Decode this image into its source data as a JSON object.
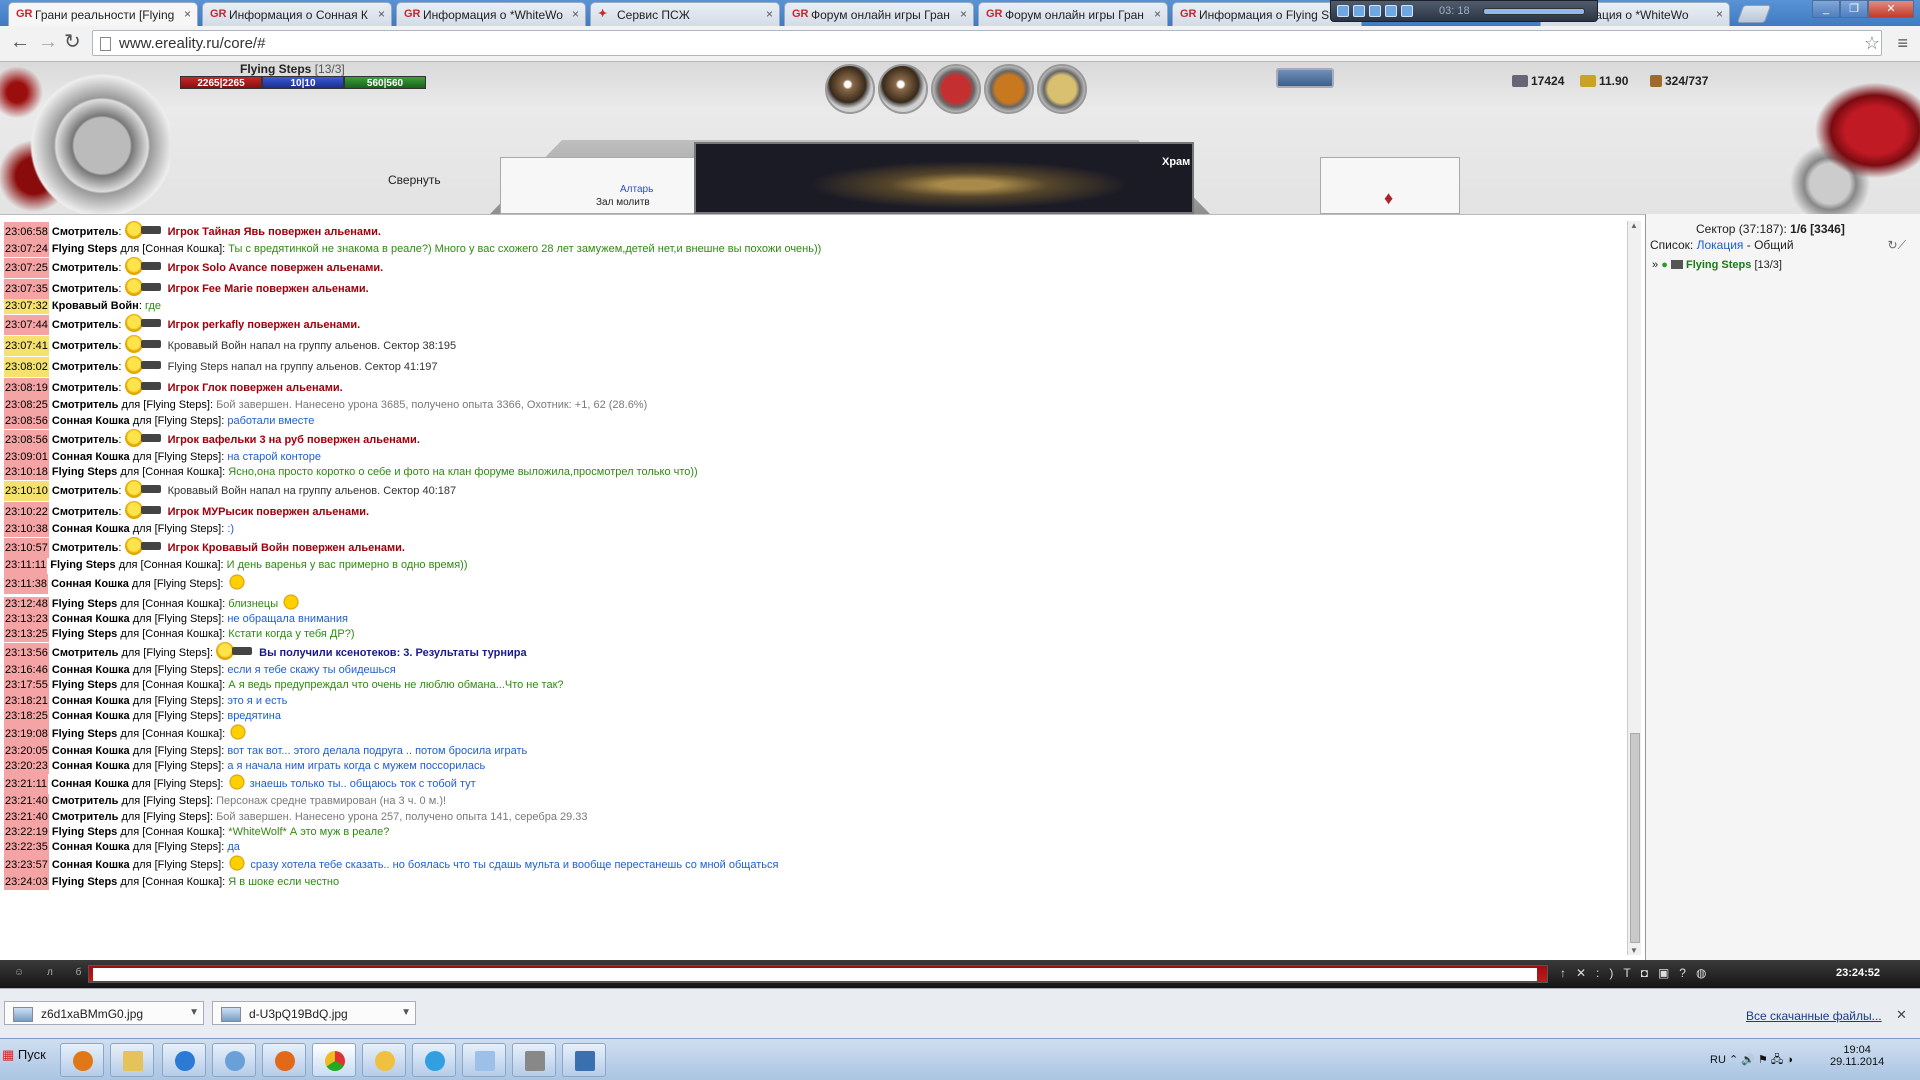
{
  "browser": {
    "tabs": [
      {
        "title": "Грани реальности [Flying"
      },
      {
        "title": "Информация о Сонная К"
      },
      {
        "title": "Информация о *WhiteWo"
      },
      {
        "title": "Сервис ПСЖ"
      },
      {
        "title": "Форум онлайн игры Гран"
      },
      {
        "title": "Форум онлайн игры Гран"
      },
      {
        "title": "Информация о Flying Ste"
      },
      {
        "title": "рормация о *WhiteWo"
      }
    ],
    "url": "www.ereality.ru/core/#",
    "media_time": "03: 18"
  },
  "player": {
    "name": "Flying Steps",
    "level": "[13/3]",
    "hp": "2265|2265",
    "mana": "10|10",
    "stamina": "560|560"
  },
  "stats": {
    "money": "17424",
    "gold": "11.90",
    "weight": "324/737"
  },
  "location": {
    "collapse_label": "Свернуть",
    "place": "Храм",
    "link": "Алтарь",
    "sub": "Зал молитв"
  },
  "chat": [
    {
      "time": "23:06:58",
      "tsc": "r",
      "name": "Смотритель",
      "sep": ":",
      "emo": "alien",
      "text": "Игрок Тайная Явь повержен альенами.",
      "cls": "sys"
    },
    {
      "time": "23:07:24",
      "tsc": "r",
      "name": "Flying Steps",
      "sep": " для [Сонная Кошка]:",
      "text": "Ты с вредятинкой не знакома в реале?) Много у вас схожего 28 лет замужем,детей нет,и внешне вы похожи очень))",
      "cls": "tx"
    },
    {
      "time": "23:07:25",
      "tsc": "r",
      "name": "Смотритель",
      "sep": ":",
      "emo": "alien",
      "text": "Игрок Solo Avance повержен альенами.",
      "cls": "sys"
    },
    {
      "time": "23:07:35",
      "tsc": "r",
      "name": "Смотритель",
      "sep": ":",
      "emo": "alien",
      "text": "Игрок Fee Marie повержен альенами.",
      "cls": "sys"
    },
    {
      "time": "23:07:32",
      "tsc": "y",
      "name": "Кровавый Войн",
      "sep": ":",
      "text": "где",
      "cls": "tx"
    },
    {
      "time": "23:07:44",
      "tsc": "r",
      "name": "Смотритель",
      "sep": ":",
      "emo": "alien",
      "text": "Игрок perkafly повержен альенами.",
      "cls": "sys"
    },
    {
      "time": "23:07:41",
      "tsc": "y",
      "name": "Смотритель",
      "sep": ":",
      "emo": "alien",
      "text": "Кровавый Войн напал на группу альенов. Сектор 38:195",
      "cls": "dk"
    },
    {
      "time": "23:08:02",
      "tsc": "y",
      "name": "Смотритель",
      "sep": ":",
      "emo": "alien",
      "text": "Flying Steps напал на группу альенов. Сектор 41:197",
      "cls": "dk"
    },
    {
      "time": "23:08:19",
      "tsc": "r",
      "name": "Смотритель",
      "sep": ":",
      "emo": "alien",
      "text": "Игрок Глок повержен альенами.",
      "cls": "sys"
    },
    {
      "time": "23:08:25",
      "tsc": "r",
      "name": "Смотритель",
      "sep": " для [Flying Steps]:",
      "text": "Бой завершен. Нанесено урона 3685, получено опыта 3366, Охотник: +1, 62 (28.6%)",
      "cls": "gr"
    },
    {
      "time": "23:08:56",
      "tsc": "r",
      "name": "Сонная Кошка",
      "sep": " для [Flying Steps]:",
      "text": "работали вместе",
      "cls": "bl"
    },
    {
      "time": "23:08:56",
      "tsc": "r",
      "name": "Смотритель",
      "sep": ":",
      "emo": "alien",
      "text": "Игрок вафельки 3 на руб повержен альенами.",
      "cls": "sys"
    },
    {
      "time": "23:09:01",
      "tsc": "r",
      "name": "Сонная Кошка",
      "sep": " для [Flying Steps]:",
      "text": "на старой конторе",
      "cls": "bl"
    },
    {
      "time": "23:10:18",
      "tsc": "r",
      "name": "Flying Steps",
      "sep": " для [Сонная Кошка]:",
      "text": "Ясно,она просто коротко о себе и фото на клан форуме выложила,просмотрел только что))",
      "cls": "tx"
    },
    {
      "time": "23:10:10",
      "tsc": "y",
      "name": "Смотритель",
      "sep": ":",
      "emo": "alien",
      "text": "Кровавый Войн напал на группу альенов. Сектор 40:187",
      "cls": "dk"
    },
    {
      "time": "23:10:22",
      "tsc": "r",
      "name": "Смотритель",
      "sep": ":",
      "emo": "alien",
      "text": "Игрок МУРысик повержен альенами.",
      "cls": "sys"
    },
    {
      "time": "23:10:38",
      "tsc": "r",
      "name": "Сонная Кошка",
      "sep": " для [Flying Steps]:",
      "text": ":)",
      "cls": "bl"
    },
    {
      "time": "23:10:57",
      "tsc": "r",
      "name": "Смотритель",
      "sep": ":",
      "emo": "alien",
      "text": "Игрок Кровавый Войн повержен альенами.",
      "cls": "sys"
    },
    {
      "time": "23:11:11",
      "tsc": "r",
      "name": "Flying Steps",
      "sep": " для [Сонная Кошка]:",
      "text": "И день варенья у вас примерно в одно время))",
      "cls": "tx"
    },
    {
      "time": "23:11:38",
      "tsc": "r",
      "name": "Сонная Кошка",
      "sep": " для [Flying Steps]:",
      "emo": "smile",
      "text": "",
      "cls": "bl"
    },
    {
      "time": "23:12:48",
      "tsc": "r",
      "name": "Flying Steps",
      "sep": " для [Сонная Кошка]:",
      "text": "близнецы",
      "cls": "tx",
      "emo_after": "music"
    },
    {
      "time": "23:13:23",
      "tsc": "r",
      "name": "Сонная Кошка",
      "sep": " для [Flying Steps]:",
      "text": "не обращала внимания",
      "cls": "bl"
    },
    {
      "time": "23:13:25",
      "tsc": "r",
      "name": "Flying Steps",
      "sep": " для [Сонная Кошка]:",
      "text": "Кстати когда у тебя ДР?)",
      "cls": "tx"
    },
    {
      "time": "23:13:56",
      "tsc": "r",
      "name": "Смотритель",
      "sep": " для [Flying Steps]:",
      "emo": "alien",
      "text": "Вы получили ксенотеков: 3. Результаты турнира",
      "cls": "pr"
    },
    {
      "time": "23:16:46",
      "tsc": "r",
      "name": "Сонная Кошка",
      "sep": " для [Flying Steps]:",
      "text": "если я тебе скажу ты обидешься",
      "cls": "bl"
    },
    {
      "time": "23:17:55",
      "tsc": "r",
      "name": "Flying Steps",
      "sep": " для [Сонная Кошка]:",
      "text": "А я ведь предупреждал что очень не люблю обмана...Что не так?",
      "cls": "tx"
    },
    {
      "time": "23:18:21",
      "tsc": "r",
      "name": "Сонная Кошка",
      "sep": " для [Flying Steps]:",
      "text": "это я и есть",
      "cls": "bl"
    },
    {
      "time": "23:18:25",
      "tsc": "r",
      "name": "Сонная Кошка",
      "sep": " для [Flying Steps]:",
      "text": "вредятина",
      "cls": "bl"
    },
    {
      "time": "23:19:08",
      "tsc": "r",
      "name": "Flying Steps",
      "sep": " для [Сонная Кошка]:",
      "emo": "laugh",
      "text": "",
      "cls": "tx"
    },
    {
      "time": "23:20:05",
      "tsc": "r",
      "name": "Сонная Кошка",
      "sep": " для [Flying Steps]:",
      "text": "вот так вот... этого делала подруга .. потом бросила играть",
      "cls": "bl"
    },
    {
      "time": "23:20:23",
      "tsc": "r",
      "name": "Сонная Кошка",
      "sep": " для [Flying Steps]:",
      "text": "а я начала ним играть когда с мужем поссорилась",
      "cls": "bl"
    },
    {
      "time": "23:21:11",
      "tsc": "r",
      "name": "Сонная Кошка",
      "sep": " для [Flying Steps]:",
      "emo": "sad",
      "text": "знаешь только ты.. общаюсь ток с тобой тут",
      "cls": "bl"
    },
    {
      "time": "23:21:40",
      "tsc": "r",
      "name": "Смотритель",
      "sep": " для [Flying Steps]:",
      "text": "Персонаж средне травмирован (на 3 ч. 0 м.)!",
      "cls": "gr"
    },
    {
      "time": "23:21:40",
      "tsc": "r",
      "name": "Смотритель",
      "sep": " для [Flying Steps]:",
      "text": "Бой завершен. Нанесено урона 257, получено опыта 141, серебра 29.33",
      "cls": "gr"
    },
    {
      "time": "23:22:19",
      "tsc": "r",
      "name": "Flying Steps",
      "sep": " для [Сонная Кошка]:",
      "text": "*WhiteWolf* А это муж в реале?",
      "cls": "tx"
    },
    {
      "time": "23:22:35",
      "tsc": "r",
      "name": "Сонная Кошка",
      "sep": " для [Flying Steps]:",
      "text": "да",
      "cls": "bl"
    },
    {
      "time": "23:23:57",
      "tsc": "r",
      "name": "Сонная Кошка",
      "sep": " для [Flying Steps]:",
      "emo": "sad",
      "text": "сразу хотела тебе сказать.. но боялась что ты сдашь мульта и вообще перестанешь со мной общаться",
      "cls": "bl"
    },
    {
      "time": "23:24:03",
      "tsc": "r",
      "name": "Flying Steps",
      "sep": " для [Сонная Кошка]:",
      "text": "Я в шоке если честно",
      "cls": "tx"
    }
  ],
  "side": {
    "sector_label": "Сектор (37:187):",
    "sector_count": "1/6 [3346]",
    "list_label": "Список:",
    "list_link": "Локация",
    "list_rest": "- Общий",
    "player_name": "Flying Steps",
    "player_level": "[13/3]"
  },
  "gamebar": {
    "time": "23:24:52",
    "input_value": ""
  },
  "downloads": {
    "items": [
      "z6d1xaBMmG0.jpg",
      "d-U3pQ19BdQ.jpg"
    ],
    "all_label": "Все скачанные файлы..."
  },
  "taskbar": {
    "start_label": "Пуск",
    "lang": "RU",
    "time": "19:04",
    "date": "29.11.2014"
  },
  "colors": {
    "accent": "#c6262e",
    "system_text": "#a0000a",
    "private_green": "#2f8a12",
    "private_blue": "#1e5fd2"
  }
}
